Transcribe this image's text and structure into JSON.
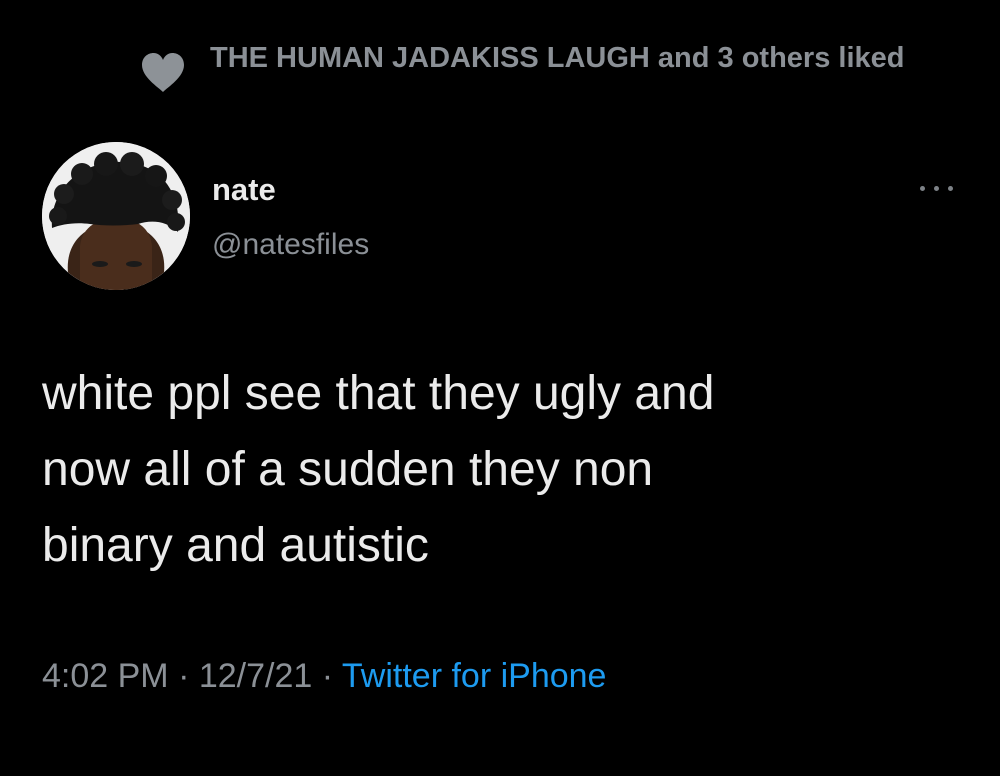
{
  "social_context": {
    "icon": "heart-icon",
    "text": "THE HUMAN JADAKISS LAUGH and 3 others liked"
  },
  "author": {
    "display_name": "nate",
    "handle": "@natesfiles",
    "avatar_icon": "avatar-photo"
  },
  "more_options": {
    "icon": "more-horizontal-icon"
  },
  "tweet": {
    "text": "white ppl see that they ugly and\nnow all of a sudden they non\nbinary and autistic",
    "time": "4:02 PM",
    "separator_1": " · ",
    "date": "12/7/21",
    "separator_2": " · ",
    "source": "Twitter for iPhone"
  },
  "colors": {
    "background": "#000000",
    "primary_text": "#ebebeb",
    "secondary_text": "#8b9096",
    "link": "#1d9bf0"
  }
}
